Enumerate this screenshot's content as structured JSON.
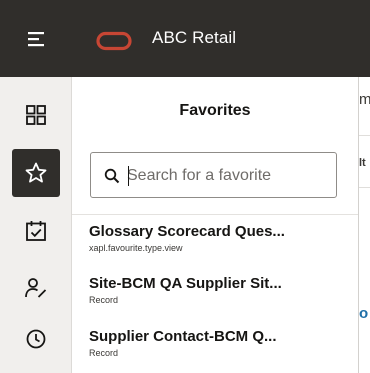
{
  "header": {
    "menu_icon": "hamburger-menu-icon",
    "logo_icon": "oracle-ring-logo",
    "app_name": "ABC Retail",
    "colors": {
      "bar": "#302e2b",
      "logo": "#c74634",
      "text": "#ffffff"
    }
  },
  "rail": {
    "items": [
      {
        "icon": "grid-icon",
        "active": false
      },
      {
        "icon": "star-icon",
        "active": true
      },
      {
        "icon": "task-checklist-icon",
        "active": false
      },
      {
        "icon": "person-edit-icon",
        "active": false
      },
      {
        "icon": "clock-icon",
        "active": false
      }
    ]
  },
  "favorites": {
    "title": "Favorites",
    "search": {
      "placeholder": "Search for a favorite",
      "icon": "search-icon"
    },
    "items": [
      {
        "name": "Glossary Scorecard Ques...",
        "type": "xapl.favourite.type.view"
      },
      {
        "name": "Site-BCM QA Supplier Sit...",
        "type": "Record"
      },
      {
        "name": "Supplier Contact-BCM Q...",
        "type": "Record"
      }
    ]
  },
  "background_page": {
    "fragments": [
      "m",
      "lt",
      "o"
    ],
    "link_color": "#1f6fa8"
  }
}
